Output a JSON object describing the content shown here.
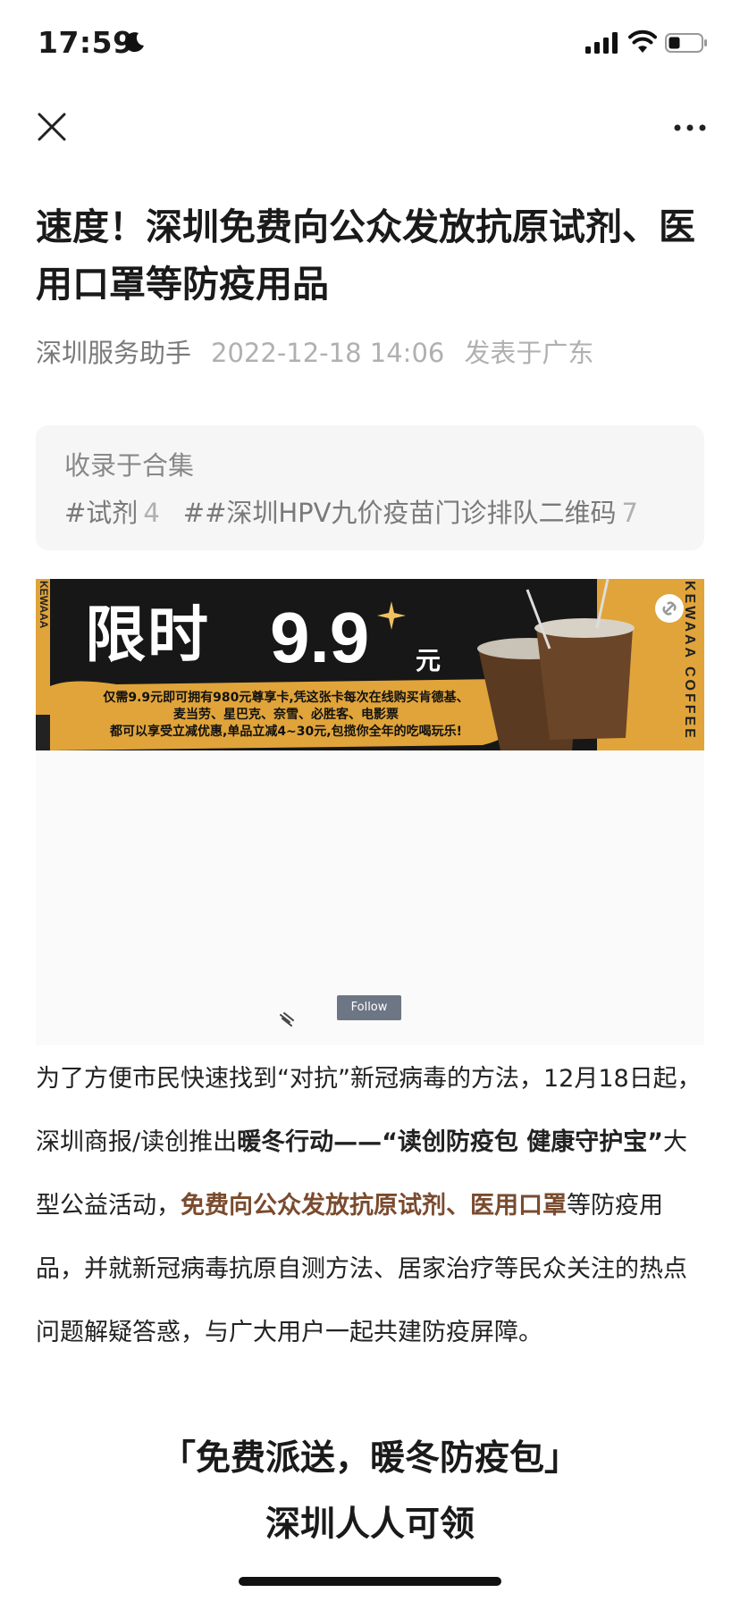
{
  "status_bar": {
    "time": "17:59"
  },
  "article": {
    "title": "速度！深圳免费向公众发放抗原试剂、医用口罩等防疫用品",
    "account": "深圳服务助手",
    "datetime": "2022-12-18 14:06",
    "location": "发表于广东"
  },
  "collection": {
    "label": "收录于合集",
    "tags": [
      {
        "name": "#试剂",
        "count": "4"
      },
      {
        "name": "##深圳HPV九价疫苗门诊排队二维码",
        "count": "7"
      }
    ]
  },
  "banner": {
    "headline": "限时",
    "price": "9.9",
    "unit": "元",
    "side_left": "KEWAAA",
    "side_right": "KEWAAA COFFEE",
    "lines": [
      "仅需9.9元即可拥有980元尊享卡,凭这张卡每次在线购买肯德基、",
      "麦当劳、星巴克、奈雪、必胜客、电影票",
      "都可以享受立减优惠,单品立减4~30元,包揽你全年的吃喝玩乐!"
    ],
    "accent": "#e0a43a"
  },
  "video": {
    "follow_label": "Follow"
  },
  "body": {
    "p1": "为了方便市民快速找到“对抗”新冠病毒的方法，12月18日起，深圳商报/读创推出",
    "p1_bold": "暖冬行动——“读创防疫包 健康守护宝”",
    "p1_after": "大型公益活动，",
    "p1_highlight": "免费向公众发放抗原试剂、医用口罩",
    "p1_end": "等防疫用品，并就新冠病毒抗原自测方法、居家治疗等民众关注的热点问题解疑答惑，与广大用户一起共建防疫屏障。"
  },
  "section_heading": {
    "line1": "「免费派送，暖冬防疫包」",
    "line2": "深圳人人可领"
  }
}
